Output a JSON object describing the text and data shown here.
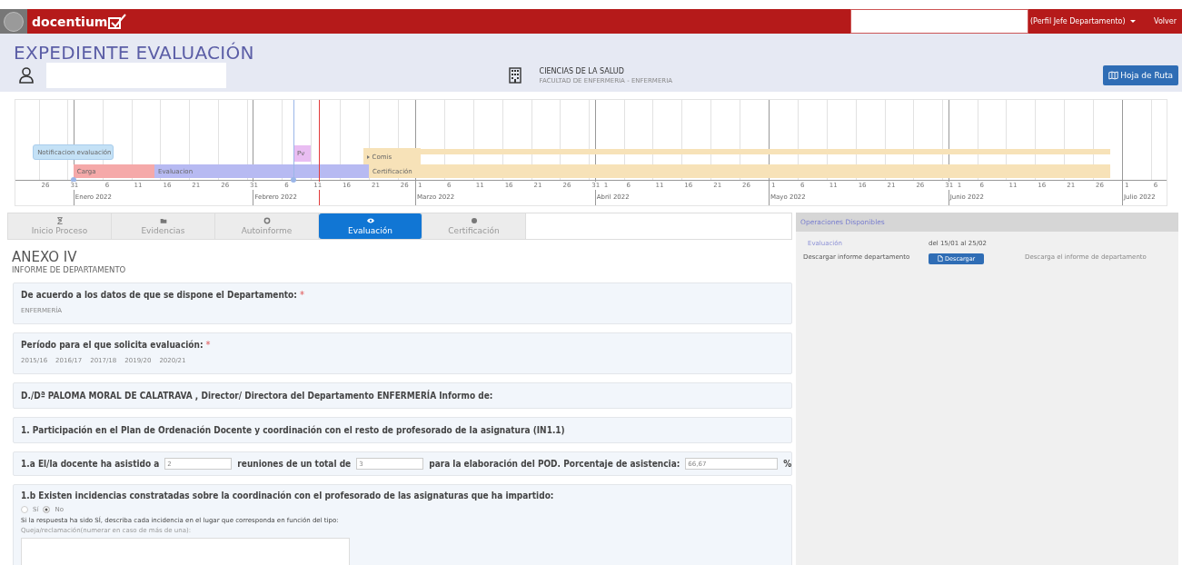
{
  "topbar": {
    "brand": "docentium",
    "profile": "(Perfil Jefe Departamento)",
    "back": "Volver"
  },
  "header": {
    "title": "EXPEDIENTE EVALUACIÓN",
    "center": "CIENCIAS DE LA SALUD",
    "center_sub": "FACULTAD DE ENFERMERIA - ENFERMERIA",
    "button": "Hoja de Ruta"
  },
  "timeline": {
    "day_ticks": [
      "26",
      "31",
      "6",
      "11",
      "16",
      "21",
      "26",
      "31",
      "6",
      "11",
      "16",
      "21",
      "26",
      "1",
      "6",
      "11",
      "16",
      "21",
      "26",
      "31",
      "1",
      "6",
      "11",
      "16",
      "21",
      "26",
      "1",
      "6",
      "11",
      "16",
      "21",
      "26",
      "31",
      "1",
      "6",
      "11",
      "16",
      "21",
      "26",
      "1",
      "6"
    ],
    "months": [
      "Enero 2022",
      "Febrero 2022",
      "Marzo 2022",
      "Abril 2022",
      "Mayo 2022",
      "Junio 2022",
      "Julio 2022"
    ],
    "bars": [
      {
        "kind": "pill",
        "label": "Notificacion evaluación",
        "color": "#c4e1f6"
      },
      {
        "kind": "upper",
        "label": "Pv",
        "color": "#e9bdf2"
      },
      {
        "kind": "band",
        "color": "#f7e2b8"
      },
      {
        "kind": "group",
        "label": "Comis",
        "color": "#f7e2b8"
      },
      {
        "kind": "lower",
        "label": "Carga",
        "color": "#f5a9a9"
      },
      {
        "kind": "lower",
        "label": "Evaluacion",
        "color": "#b7baf2"
      },
      {
        "kind": "lower",
        "label": "Certificación",
        "color": "#f7e2b8"
      }
    ]
  },
  "tabs": [
    {
      "label": "Inicio Proceso",
      "selected": false
    },
    {
      "label": "Evidencias",
      "selected": false
    },
    {
      "label": "Autoinforme",
      "selected": false
    },
    {
      "label": "Evaluación",
      "selected": true
    },
    {
      "label": "Certificación",
      "selected": false
    }
  ],
  "form": {
    "title": "ANEXO IV",
    "subtitle": "INFORME DE DEPARTAMENTO",
    "sections": [
      {
        "kind": "field",
        "label": "De acuerdo a los datos de que se dispone el Departamento:",
        "required_mark": "*",
        "values": [
          "ENFERMERÍA"
        ]
      },
      {
        "kind": "field",
        "label": "Período para el que solicita evaluación:",
        "required_mark": "*",
        "values": [
          "2015/16",
          "2016/17",
          "2017/18",
          "2019/20",
          "2020/21"
        ]
      },
      {
        "kind": "text",
        "text": "D./Dª  PALOMA MORAL DE CALATRAVA  , Director/ Directora del Departamento  ENFERMERÍA  Informo de:"
      },
      {
        "kind": "text",
        "text": "1. Participación en el Plan de Ordenación Docente y coordinación con el resto de profesorado de la asignatura (IN1.1)"
      },
      {
        "kind": "inline",
        "parts": [
          {
            "text": "1.a El/la docente ha asistido a"
          },
          {
            "input": "2"
          },
          {
            "text": "reuniones de un total de"
          },
          {
            "input": "3"
          },
          {
            "text": "para la elaboración del POD. Porcentaje de asistencia:"
          },
          {
            "input": "66,67"
          },
          {
            "text": "%"
          }
        ]
      },
      {
        "kind": "question",
        "label": "1.b Existen incidencias constratadas sobre la coordinación con el profesorado de las asignaturas que ha impartido:",
        "options": [
          {
            "label": "Sí",
            "selected": false
          },
          {
            "label": "No",
            "selected": true
          }
        ],
        "instructions": "Si la respuesta ha sido SÍ, describa cada incidencia en el lugar que corresponda en función del tipo:",
        "textarea_label": "Queja/reclamación(numerar en caso de más de una):"
      }
    ]
  },
  "operations": {
    "title": "Operaciones Disponibles",
    "rows": [
      {
        "kind": "period",
        "name": "Evaluación",
        "value": "del 15/01 al 25/02"
      },
      {
        "kind": "action",
        "name": "Descargar informe departamento",
        "button": "Descargar",
        "description": "Descarga el informe de departamento"
      }
    ]
  }
}
